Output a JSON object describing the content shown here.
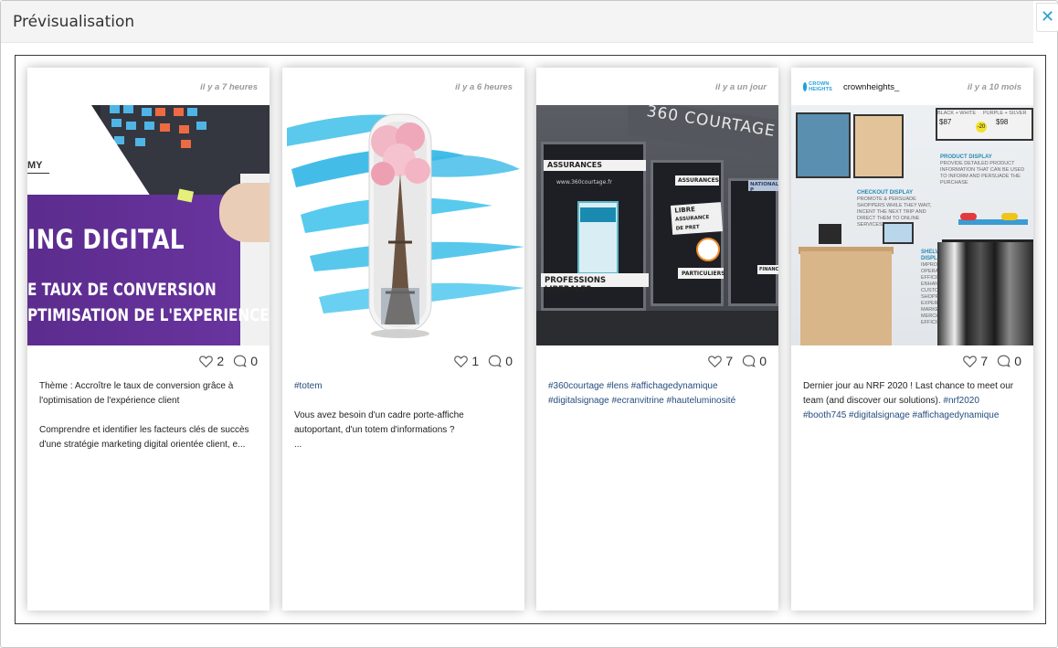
{
  "modal": {
    "title": "Prévisualisation",
    "close_icon": "✕"
  },
  "cards": [
    {
      "time": "il y a 7 heures",
      "user": "",
      "likes": "2",
      "comments": "0",
      "image": {
        "title_line1": "ING DIGITAL",
        "title_line2": "E TAUX DE CONVERSION",
        "title_line3": "PTIMISATION DE L'EXPERIENCE CLIE",
        "logo_fragment": "MY"
      },
      "text": "Thème : Accroître le taux de conversion grâce à l'optimisation de l'expérience client\n\nComprendre et identifier les facteurs clés de succès d'une stratégie marketing digital orientée client, e..."
    },
    {
      "time": "il y a 6 heures",
      "user": "",
      "likes": "1",
      "comments": "0",
      "tags": "#totem",
      "text": "Vous avez besoin d'un cadre porte-affiche autoportant, d'un totem d'informations ?\n..."
    },
    {
      "time": "il y a un jour",
      "user": "",
      "likes": "7",
      "comments": "0",
      "image": {
        "sign": "360 COURTAGE",
        "assurances": "ASSURANCES",
        "professions": "PROFESSIONS LIBERALES",
        "particuliers": "PARTICULIERS",
        "libre": "LIBRE",
        "choix": "ASSURANCE DE PRET",
        "website": "www.360courtage.fr",
        "national": "NATIONAL P",
        "finance": "FINANCE"
      },
      "tags": "#360courtage #lens #affichagedynamique #digitalsignage #ecranvitrine #hauteluminosité"
    },
    {
      "time": "il y a 10 mois",
      "user": "crownheights_",
      "logo_text": "CROWN HEIGHTS",
      "likes": "7",
      "comments": "0",
      "image": {
        "product_title": "PRODUCT DISPLAY",
        "product_desc": "PROVIDE DETAILED PRODUCT INFORMATION THAT CAN BE USED TO INFORM AND PERSUADE THE PURCHASE",
        "checkout_title": "CHECKOUT DISPLAY",
        "checkout_desc": "PROMOTE & PERSUADE SHOPPERS WHILE THEY WAIT, INCENT THE NEXT TRIP AND DIRECT THEM TO ONLINE SERVICES",
        "shelves_title": "SHELVES & TABLET DISPLAY",
        "shelves_desc": "IMPROVE OPERATIONAL EFFICIENCY, ENHANCE THE CUSTOMER SHOPPING EXPERIENCE, MARKETING AND MERCHANDISING EFFICIENCY",
        "price1": "$87",
        "price2": "$98",
        "promo": "-20",
        "shoe1": "BLACK + WHITE",
        "shoe2": "PURPLE + SILVER"
      },
      "text": "Dernier jour au NRF 2020 ! Last chance to meet our team (and discover our solutions). ",
      "tags": "#nrf2020 #booth745 #digitalsignage #affichagedynamique"
    }
  ],
  "icons": {
    "like": "heart-icon",
    "comment": "comment-icon"
  },
  "colors": {
    "accent": "#2a9fa8",
    "close": "#2aa1c9",
    "hashtag": "#254d7d",
    "purple": "#5b2d8f"
  }
}
